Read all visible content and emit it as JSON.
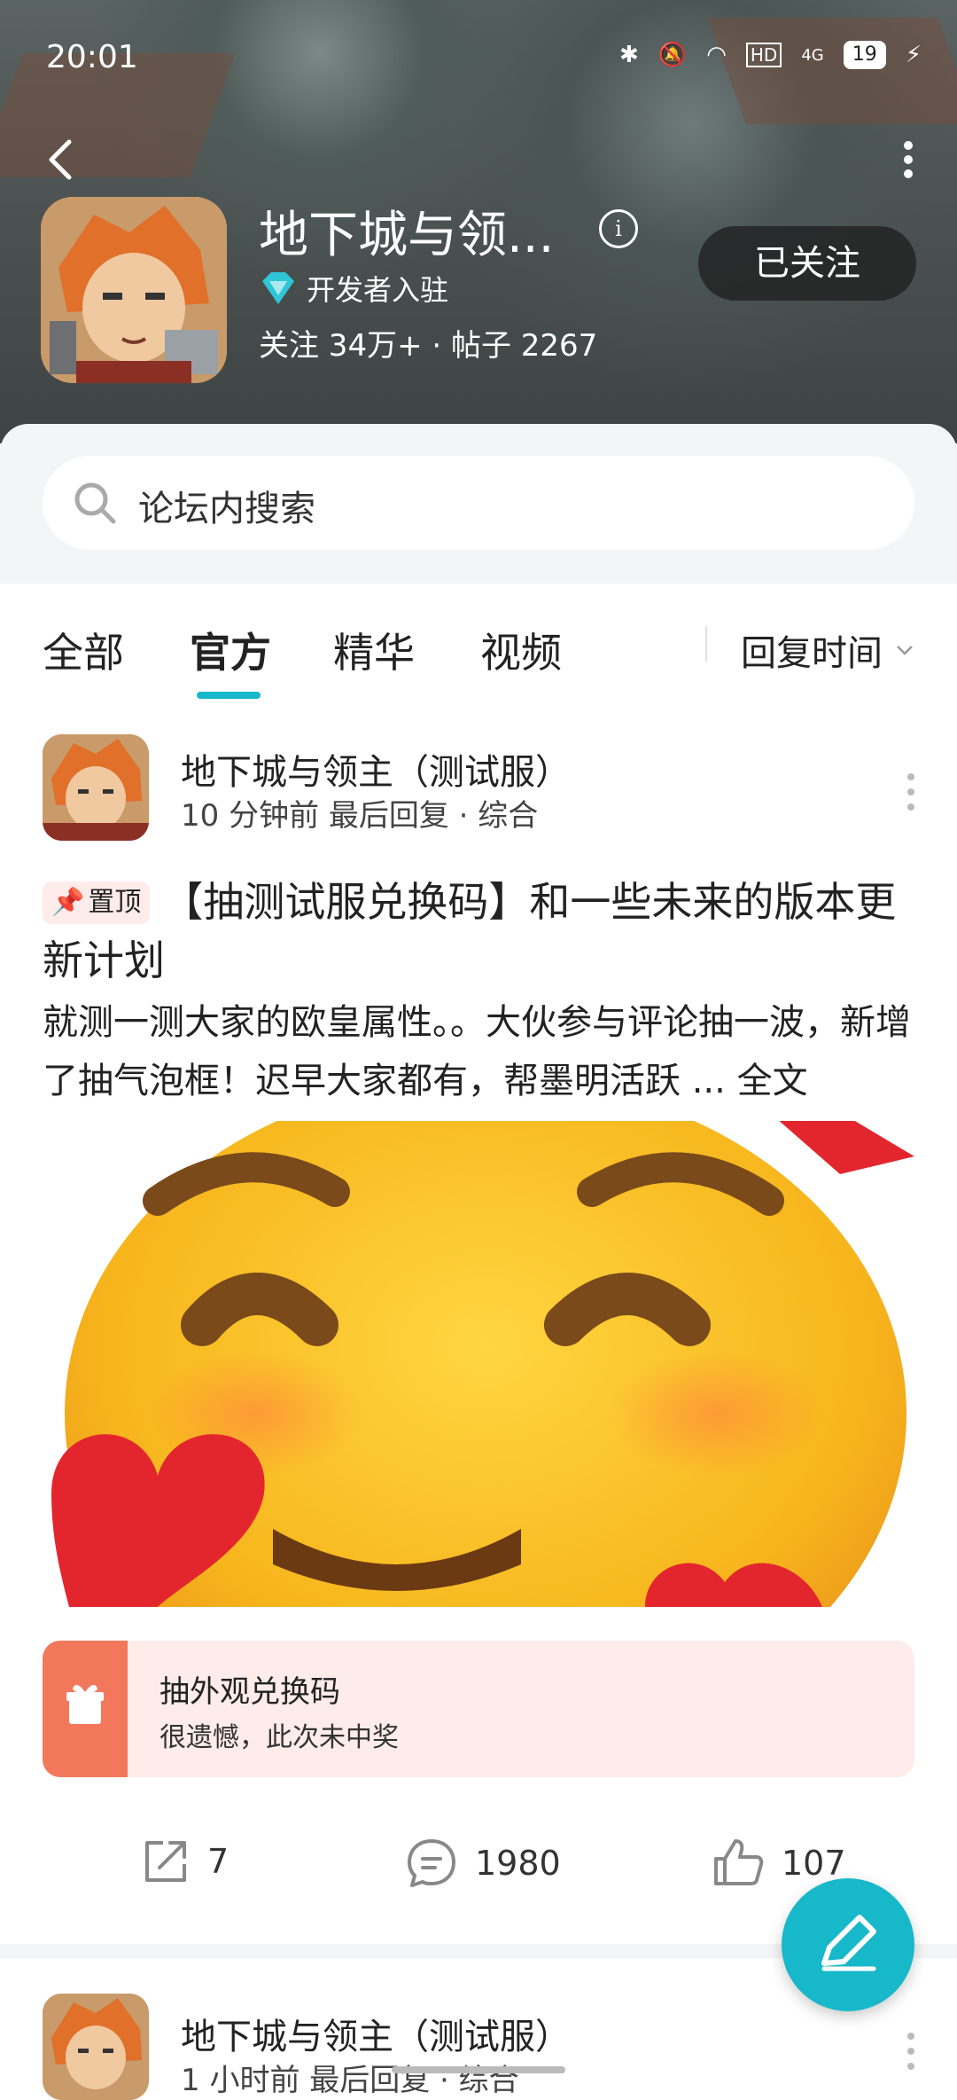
{
  "status_bar": {
    "time": "20:01",
    "battery": "19",
    "net": "HD",
    "net2": "4G"
  },
  "forum": {
    "title": "地下城与领...",
    "developer_badge": "开发者入驻",
    "stats": "关注 34万+ · 帖子 2267",
    "follow_label": "已关注"
  },
  "search": {
    "placeholder": "论坛内搜索"
  },
  "tabs": [
    {
      "label": "全部"
    },
    {
      "label": "官方",
      "active": true
    },
    {
      "label": "精华"
    },
    {
      "label": "视频"
    }
  ],
  "sort": {
    "label": "回复时间"
  },
  "post": {
    "author": "地下城与领主（测试服）",
    "meta": "10 分钟前 最后回复 · 综合",
    "pin_label": "置顶",
    "title": "【抽测试服兑换码】和一些未来的版本更新计划",
    "body": "就测一测大家的欧皇属性。。大伙参与评论抽一波，新增了抽气泡框！迟早大家都有，帮墨明活跃 ... 全文",
    "prize_title": "抽外观兑换码",
    "prize_subtitle": "很遗憾，此次未中奖",
    "share_count": "7",
    "comment_count": "1980",
    "like_count": "107"
  },
  "post2": {
    "author": "地下城与领主（测试服）",
    "meta": "1 小时前 最后回复 · 综合"
  },
  "colors": {
    "accent": "#17b8c9",
    "prize": "#f3785b"
  }
}
